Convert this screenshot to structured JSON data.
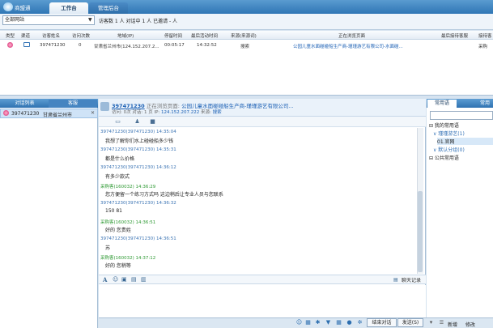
{
  "app": {
    "name": "商盟通"
  },
  "tabs": [
    {
      "label": "工作台"
    },
    {
      "label": "管理后台"
    }
  ],
  "filter": {
    "site": "全部网站",
    "status_text": "访客数 1 人  对话中 1 人  已邀请 - 人"
  },
  "visit_table": {
    "columns": [
      "类型",
      "渠道",
      "访客姓名",
      "访问次数",
      "地域(IP)",
      "停留时间",
      "最后活动时间",
      "来源(来源词)",
      "正在浏览页面",
      "最后接待客服",
      "接待客"
    ],
    "rows": [
      {
        "name": "397471230",
        "visits": "0",
        "region": "甘肃省兰州市(124.152.207.2...",
        "stay": "00:05:17",
        "last_active": "14:32:52",
        "source": "搜索",
        "page": "公园儿童水面碰碰船生产商-瑾瑾游艺有限公司-水面碰...",
        "agent": "",
        "receiver": "采购"
      }
    ]
  },
  "left_panel": {
    "tabs": [
      "对话列表",
      "客服"
    ],
    "items": [
      {
        "id": "397471230",
        "location": "甘肃省兰州市"
      }
    ]
  },
  "chat_header": {
    "visitor": "397471230",
    "browsing_label": "正在浏览页面:",
    "browsing_page": "公园儿童水面碰碰船生产商-瑾瑾游艺有限公司...",
    "line2_prefix": "访问: 0次 对话: 1",
    "line2_page": "页  IP:",
    "ip": "124.152.207.222",
    "source_label": "来源:",
    "source": "搜索"
  },
  "messages": [
    {
      "meta": "397471230(397471230)  14:35:04",
      "who": "visitor",
      "text": "我想了解你们水上碰碰船多少钱"
    },
    {
      "meta": "397471230(397471230)  14:35:31",
      "who": "visitor",
      "text": "都是什么价格"
    },
    {
      "meta": "397471230(397471230)  14:36:12",
      "who": "visitor",
      "text": "有多少款式"
    },
    {
      "meta": "采购客(160032)  14:36:29",
      "who": "agent",
      "text": "您方便留一个练习方式吗 这边稍后让专业人员与您联系"
    },
    {
      "meta": "397471230(397471230)  14:36:32",
      "who": "visitor",
      "text": "150            81"
    },
    {
      "meta": "采购客(160032)  14:36:51",
      "who": "agent",
      "text": "好的 您贵姓"
    },
    {
      "meta": "397471230(397471230)  14:36:51",
      "who": "visitor",
      "text": "苏"
    },
    {
      "meta": "采购客(160032)  14:37:12",
      "who": "agent",
      "text": "好的 您稍等"
    }
  ],
  "chat_tools": {
    "history": "聊天记录"
  },
  "bottom": {
    "end": "结束对话",
    "send": "发送(S)"
  },
  "right_panel": {
    "tabs": [
      "常用语",
      "常用"
    ],
    "tree": [
      {
        "label": "我的常用语",
        "level": 0,
        "color": "#222"
      },
      {
        "label": "瑾瑾游艺(1)",
        "level": 1,
        "color": "#2f6fb5"
      },
      {
        "label": "01.官网",
        "level": 2,
        "color": "#222"
      },
      {
        "label": "默认分组(0)",
        "level": 1,
        "color": "#2f6fb5"
      },
      {
        "label": "公共常用语",
        "level": 0,
        "color": "#222"
      }
    ],
    "new_label": "新增",
    "edit_label": "修改"
  }
}
